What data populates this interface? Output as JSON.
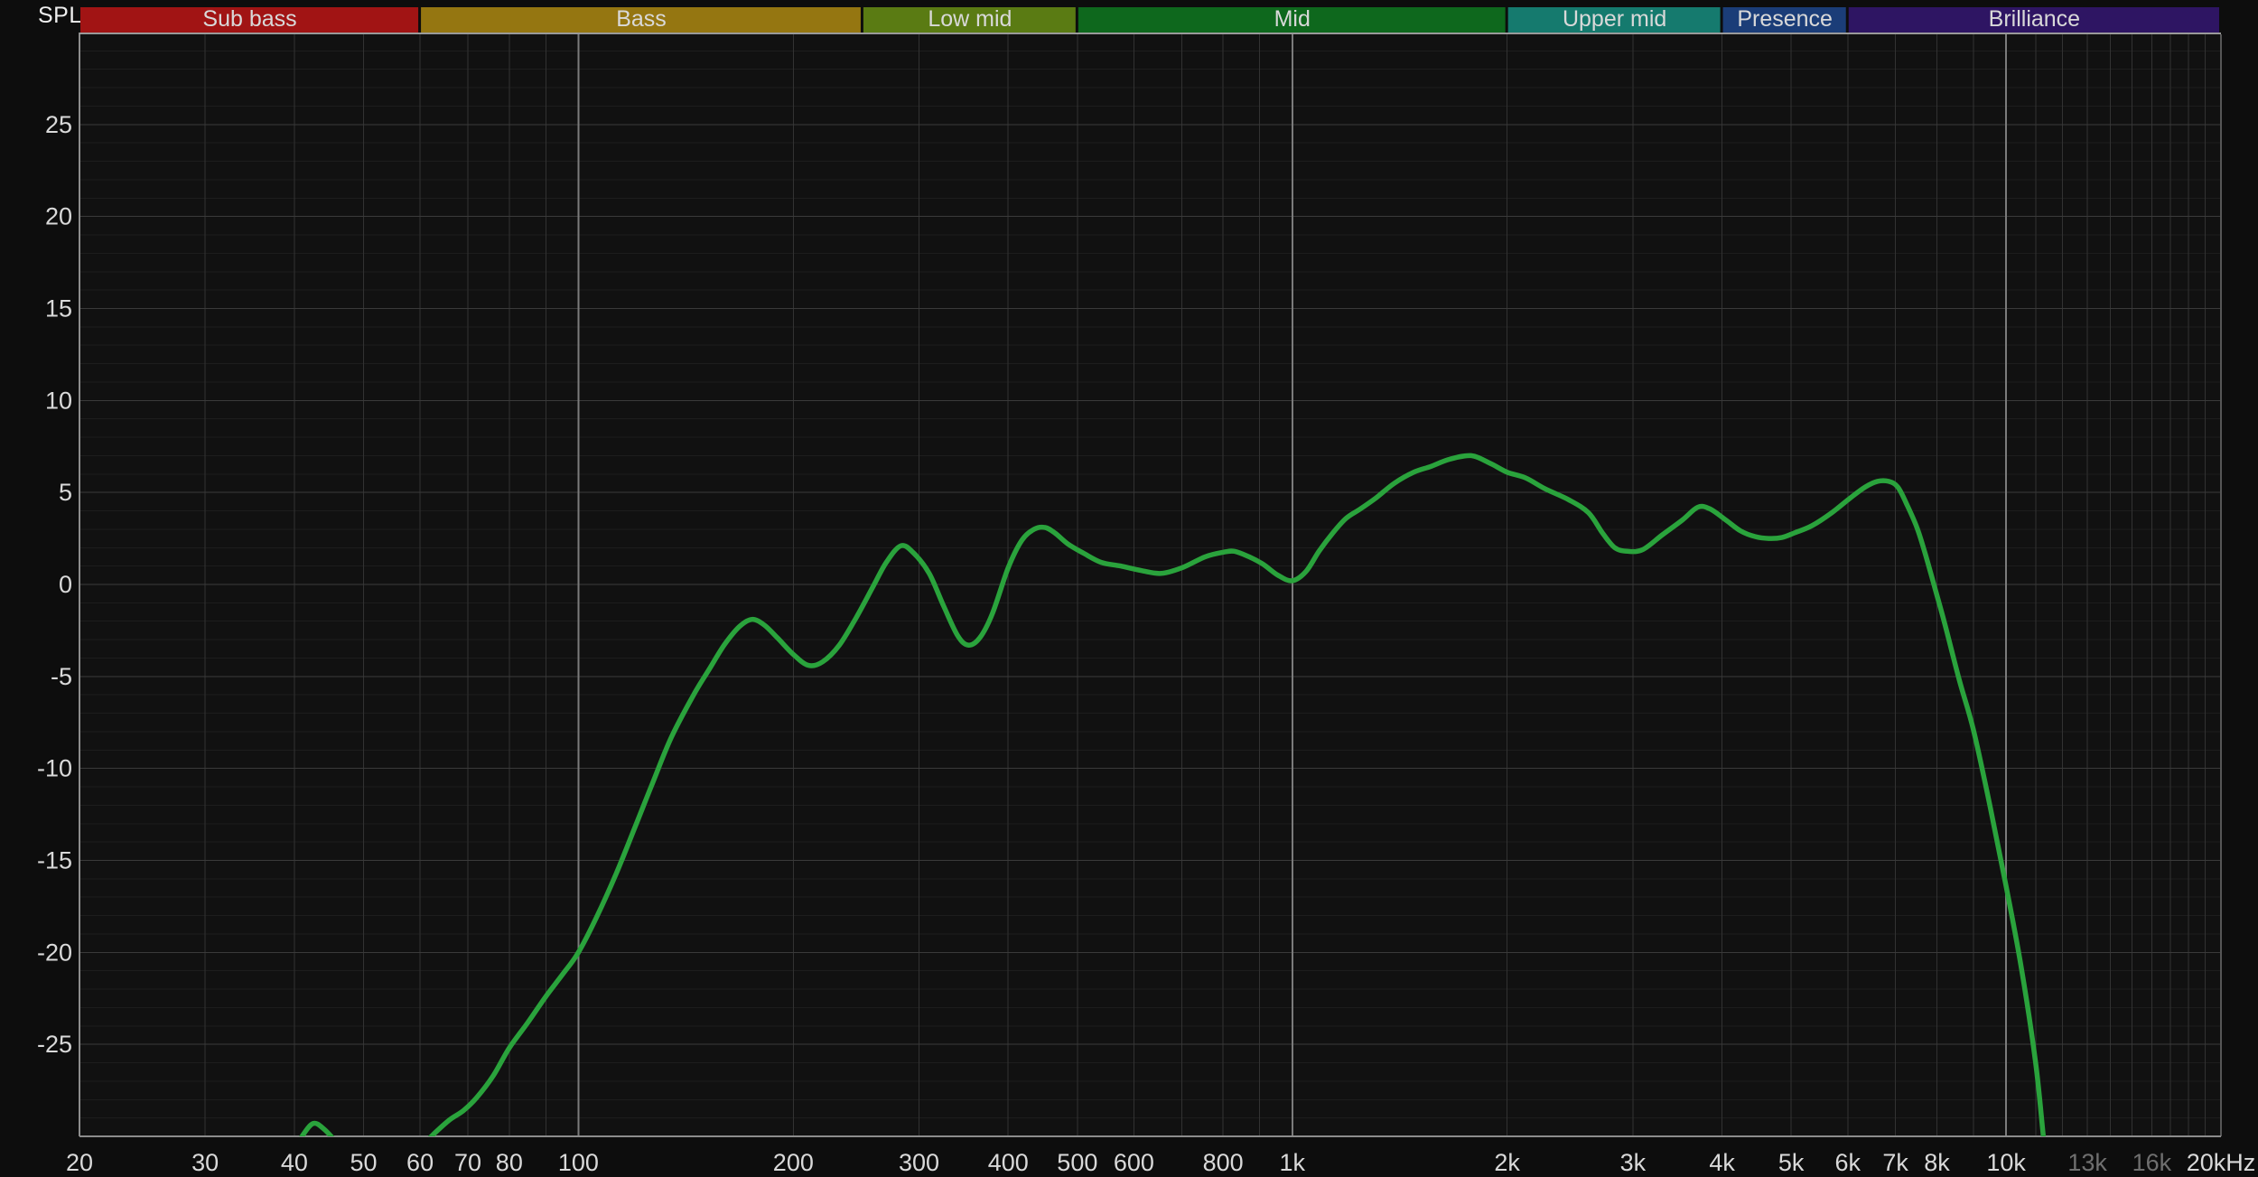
{
  "chart_data": {
    "type": "line",
    "title": "",
    "ylabel": "SPL",
    "x_axis": {
      "scale": "log",
      "min_hz": 20,
      "max_hz": 20000,
      "ticks": [
        {
          "label": "20",
          "f": 20
        },
        {
          "label": "30",
          "f": 30
        },
        {
          "label": "40",
          "f": 40
        },
        {
          "label": "50",
          "f": 50
        },
        {
          "label": "60",
          "f": 60
        },
        {
          "label": "70",
          "f": 70
        },
        {
          "label": "80",
          "f": 80
        },
        {
          "label": "100",
          "f": 100
        },
        {
          "label": "200",
          "f": 200
        },
        {
          "label": "300",
          "f": 300
        },
        {
          "label": "400",
          "f": 400
        },
        {
          "label": "500",
          "f": 500
        },
        {
          "label": "600",
          "f": 600
        },
        {
          "label": "800",
          "f": 800
        },
        {
          "label": "1k",
          "f": 1000
        },
        {
          "label": "2k",
          "f": 2000
        },
        {
          "label": "3k",
          "f": 3000
        },
        {
          "label": "4k",
          "f": 4000
        },
        {
          "label": "5k",
          "f": 5000
        },
        {
          "label": "6k",
          "f": 6000
        },
        {
          "label": "7k",
          "f": 7000
        },
        {
          "label": "8k",
          "f": 8000
        },
        {
          "label": "10k",
          "f": 10000
        },
        {
          "label": "13k",
          "f": 13000,
          "dim": true
        },
        {
          "label": "16k",
          "f": 16000,
          "dim": true
        },
        {
          "label": "20kHz",
          "f": 20000
        }
      ],
      "minor_gridlines": [
        30,
        40,
        50,
        60,
        70,
        80,
        90,
        200,
        300,
        400,
        500,
        600,
        700,
        800,
        900,
        2000,
        3000,
        4000,
        5000,
        6000,
        7000,
        8000,
        9000,
        11000,
        12000,
        13000,
        14000,
        15000,
        16000,
        17000,
        18000,
        19000
      ],
      "decade_gridlines": [
        100,
        1000,
        10000
      ]
    },
    "y_axis": {
      "unit": "dB",
      "min": -30,
      "max": 30,
      "major_step": 5,
      "minor_step": 1,
      "ticks": [
        25,
        20,
        15,
        10,
        5,
        0,
        -5,
        -10,
        -15,
        -20,
        -25
      ]
    },
    "bands": [
      {
        "label": "Sub bass",
        "range_hz": [
          20,
          60
        ],
        "color": "#a11414"
      },
      {
        "label": "Bass",
        "range_hz": [
          60,
          250
        ],
        "color": "#957611"
      },
      {
        "label": "Low mid",
        "range_hz": [
          250,
          500
        ],
        "color": "#5a7b13"
      },
      {
        "label": "Mid",
        "range_hz": [
          500,
          2000
        ],
        "color": "#0e681d"
      },
      {
        "label": "Upper mid",
        "range_hz": [
          2000,
          4000
        ],
        "color": "#157a6e"
      },
      {
        "label": "Presence",
        "range_hz": [
          4000,
          6000
        ],
        "color": "#1b3d78"
      },
      {
        "label": "Brilliance",
        "range_hz": [
          6000,
          20000
        ],
        "color": "#2e1563"
      }
    ],
    "series": [
      {
        "name": "frequency-response",
        "color": "#2aa33c",
        "points": [
          [
            40,
            -30.8
          ],
          [
            41,
            -30.0
          ],
          [
            42.5,
            -29.3
          ],
          [
            44,
            -29.6
          ],
          [
            46,
            -30.4
          ],
          [
            48,
            -31.2
          ],
          [
            52,
            -31.6
          ],
          [
            56,
            -31.4
          ],
          [
            60,
            -30.6
          ],
          [
            63,
            -29.8
          ],
          [
            66,
            -29.1
          ],
          [
            69,
            -28.6
          ],
          [
            72,
            -27.9
          ],
          [
            76,
            -26.7
          ],
          [
            80,
            -25.2
          ],
          [
            85,
            -23.8
          ],
          [
            90,
            -22.4
          ],
          [
            95,
            -21.2
          ],
          [
            100,
            -20.0
          ],
          [
            106,
            -18.1
          ],
          [
            113,
            -15.7
          ],
          [
            120,
            -13.2
          ],
          [
            127,
            -10.8
          ],
          [
            135,
            -8.3
          ],
          [
            145,
            -6.0
          ],
          [
            152,
            -4.7
          ],
          [
            160,
            -3.3
          ],
          [
            168,
            -2.3
          ],
          [
            175,
            -1.9
          ],
          [
            182,
            -2.2
          ],
          [
            190,
            -2.9
          ],
          [
            200,
            -3.8
          ],
          [
            210,
            -4.4
          ],
          [
            220,
            -4.2
          ],
          [
            232,
            -3.3
          ],
          [
            245,
            -1.8
          ],
          [
            258,
            -0.2
          ],
          [
            270,
            1.2
          ],
          [
            283,
            2.1
          ],
          [
            295,
            1.7
          ],
          [
            310,
            0.6
          ],
          [
            325,
            -1.2
          ],
          [
            340,
            -2.8
          ],
          [
            352,
            -3.3
          ],
          [
            365,
            -2.9
          ],
          [
            380,
            -1.6
          ],
          [
            400,
            0.9
          ],
          [
            418,
            2.4
          ],
          [
            435,
            3.0
          ],
          [
            450,
            3.1
          ],
          [
            465,
            2.8
          ],
          [
            485,
            2.2
          ],
          [
            510,
            1.7
          ],
          [
            540,
            1.2
          ],
          [
            575,
            1.0
          ],
          [
            615,
            0.75
          ],
          [
            655,
            0.6
          ],
          [
            700,
            0.9
          ],
          [
            755,
            1.5
          ],
          [
            800,
            1.75
          ],
          [
            830,
            1.8
          ],
          [
            870,
            1.5
          ],
          [
            910,
            1.1
          ],
          [
            955,
            0.5
          ],
          [
            1000,
            0.2
          ],
          [
            1045,
            0.7
          ],
          [
            1090,
            1.8
          ],
          [
            1140,
            2.8
          ],
          [
            1190,
            3.6
          ],
          [
            1245,
            4.1
          ],
          [
            1310,
            4.7
          ],
          [
            1390,
            5.5
          ],
          [
            1480,
            6.1
          ],
          [
            1560,
            6.4
          ],
          [
            1660,
            6.8
          ],
          [
            1780,
            7.0
          ],
          [
            1890,
            6.6
          ],
          [
            2000,
            6.1
          ],
          [
            2120,
            5.8
          ],
          [
            2260,
            5.2
          ],
          [
            2440,
            4.6
          ],
          [
            2600,
            3.9
          ],
          [
            2720,
            2.8
          ],
          [
            2830,
            2.0
          ],
          [
            2950,
            1.8
          ],
          [
            3100,
            1.9
          ],
          [
            3300,
            2.7
          ],
          [
            3520,
            3.5
          ],
          [
            3700,
            4.2
          ],
          [
            3850,
            4.1
          ],
          [
            4050,
            3.5
          ],
          [
            4250,
            2.9
          ],
          [
            4450,
            2.6
          ],
          [
            4650,
            2.5
          ],
          [
            4850,
            2.55
          ],
          [
            5050,
            2.8
          ],
          [
            5350,
            3.2
          ],
          [
            5700,
            3.9
          ],
          [
            6050,
            4.7
          ],
          [
            6350,
            5.3
          ],
          [
            6600,
            5.6
          ],
          [
            6850,
            5.6
          ],
          [
            7050,
            5.3
          ],
          [
            7250,
            4.4
          ],
          [
            7500,
            3.1
          ],
          [
            7700,
            1.7
          ],
          [
            7950,
            -0.2
          ],
          [
            8200,
            -2.1
          ],
          [
            8600,
            -5.2
          ],
          [
            9000,
            -7.9
          ],
          [
            9500,
            -12.1
          ],
          [
            10000,
            -16.4
          ],
          [
            10500,
            -20.8
          ],
          [
            11000,
            -26.0
          ],
          [
            11300,
            -30.3
          ],
          [
            11500,
            -32.5
          ]
        ]
      }
    ],
    "colors": {
      "background": "#0d0d0d",
      "plot_background": "#111111",
      "grid_minor_h": "#1d1d1d",
      "grid_major_h": "#3a3a3a",
      "grid_minor_v": "#323232",
      "grid_decade_v": "#7b7b7b",
      "axis_line": "#8c8c8c",
      "right_border": "#565656",
      "header_underline": "#9a9a9a",
      "tick_label": "#d9d9d9",
      "tick_label_dim": "#6f6f6f",
      "band_label": "#d9d9d9",
      "ylabel_color": "#efefef"
    }
  }
}
